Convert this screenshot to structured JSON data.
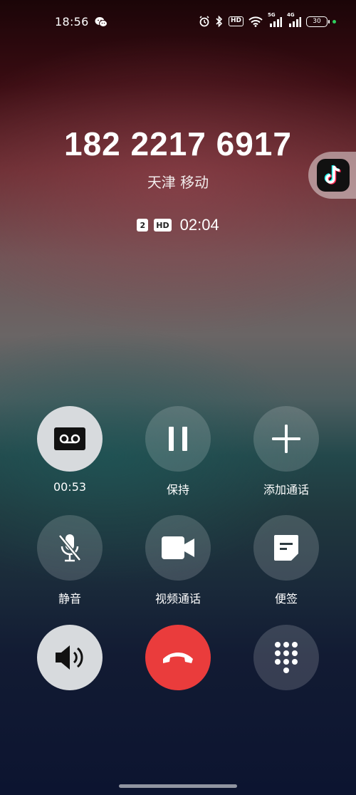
{
  "status_bar": {
    "time": "18:56",
    "hd_label": "HD",
    "net1": "5G",
    "net2": "4G",
    "battery": "30",
    "icons": [
      "wechat-icon",
      "alarm-icon",
      "bluetooth-icon",
      "hd-icon",
      "wifi-icon",
      "signal-icon",
      "signal-icon",
      "battery-icon"
    ]
  },
  "call": {
    "number": "182 2217 6917",
    "location": "天津 移动",
    "sim": "2",
    "hd": "HD",
    "duration": "02:04"
  },
  "floating_app": {
    "icon": "tiktok-icon"
  },
  "controls": {
    "record": {
      "label": "00:53",
      "icon": "record-icon"
    },
    "hold": {
      "label": "保持",
      "icon": "pause-icon"
    },
    "add_call": {
      "label": "添加通话",
      "icon": "plus-icon"
    },
    "mute": {
      "label": "静音",
      "icon": "mic-off-icon"
    },
    "video": {
      "label": "视频通话",
      "icon": "video-icon"
    },
    "notes": {
      "label": "便签",
      "icon": "note-icon"
    },
    "speaker": {
      "icon": "speaker-icon"
    },
    "end_call": {
      "icon": "hangup-icon",
      "color": "#ea3c3c"
    },
    "dialpad": {
      "icon": "dialpad-icon"
    }
  }
}
